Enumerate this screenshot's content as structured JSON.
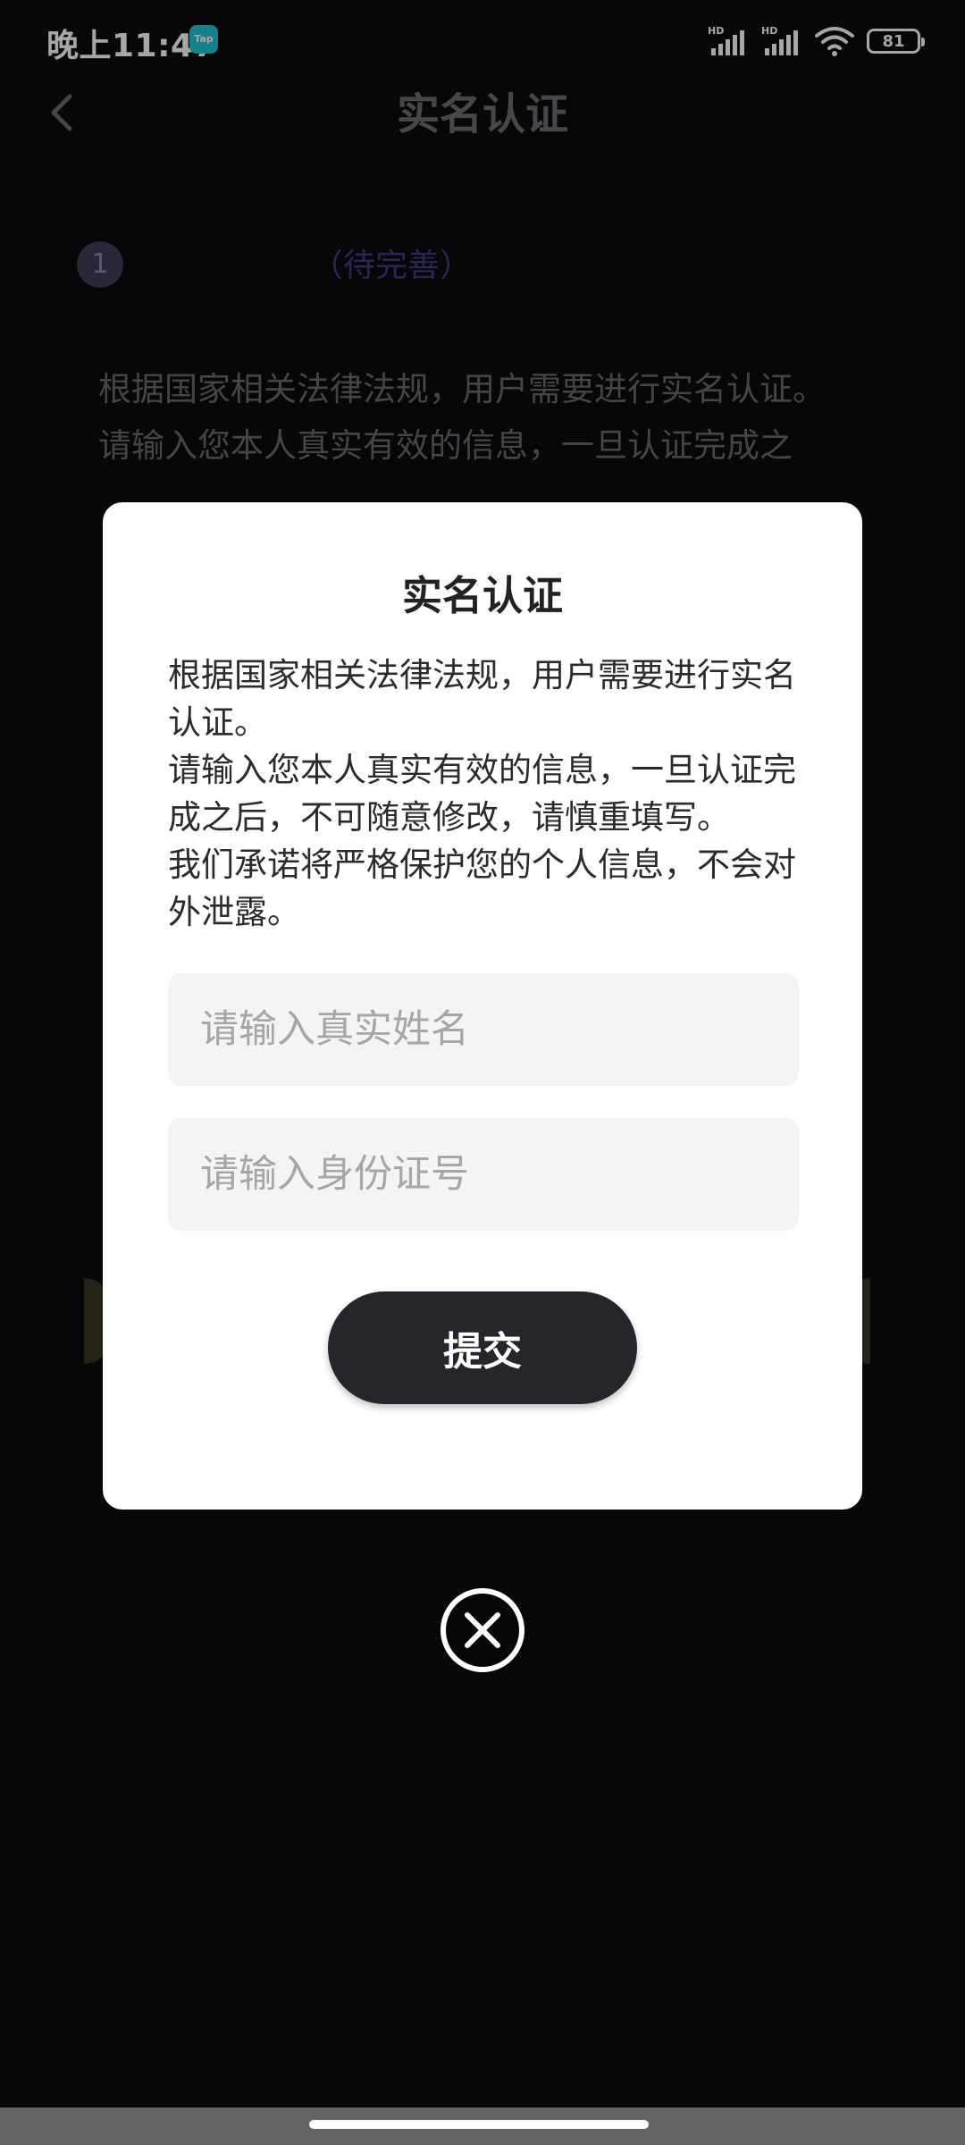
{
  "status_bar": {
    "time": "晚上11:47",
    "app_badge": "Tap",
    "hd_label_1": "HD",
    "hd_label_2": "HD",
    "battery": "81"
  },
  "background_page": {
    "title": "实名认证",
    "step_number": "1",
    "step_status": "（待完善）",
    "notice_line_1": "根据国家相关法律法规，用户需要进行实名认证。",
    "notice_line_2": "请输入您本人真实有效的信息，一旦认证完成之"
  },
  "modal": {
    "title": "实名认证",
    "paragraphs": [
      "根据国家相关法律法规，用户需要进行实名认证。",
      "请输入您本人真实有效的信息，一旦认证完成之后，不可随意修改，请慎重填写。",
      "我们承诺将严格保护您的个人信息，不会对外泄露。"
    ],
    "name_input": {
      "placeholder": "请输入真实姓名",
      "value": ""
    },
    "id_input": {
      "placeholder": "请输入身份证号",
      "value": ""
    },
    "submit_label": "提交"
  },
  "icons": {
    "back": "chevron-left-icon",
    "close": "close-circle-icon",
    "signal": "signal-icon",
    "wifi": "wifi-icon",
    "battery": "battery-icon"
  },
  "colors": {
    "background": "#0b0b10",
    "modal": "#ffffff",
    "button": "#24262b",
    "input_bg": "#f4f4f4",
    "step_status": "#3f3b7d"
  }
}
